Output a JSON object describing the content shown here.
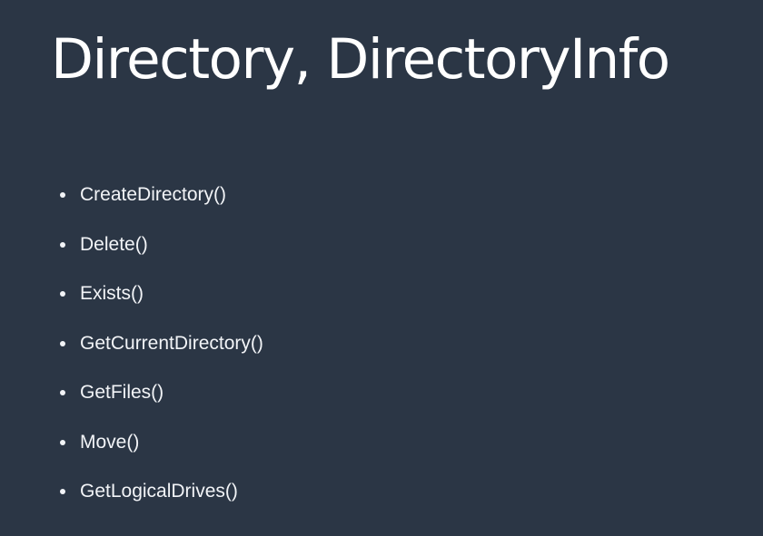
{
  "slide": {
    "title": "Directory, DirectoryInfo",
    "bullets": [
      "CreateDirectory()",
      "Delete()",
      "Exists()",
      "GetCurrentDirectory()",
      "GetFiles()",
      "Move()",
      "GetLogicalDrives()"
    ]
  },
  "colors": {
    "background": "#2b3645",
    "text": "#ffffff"
  }
}
